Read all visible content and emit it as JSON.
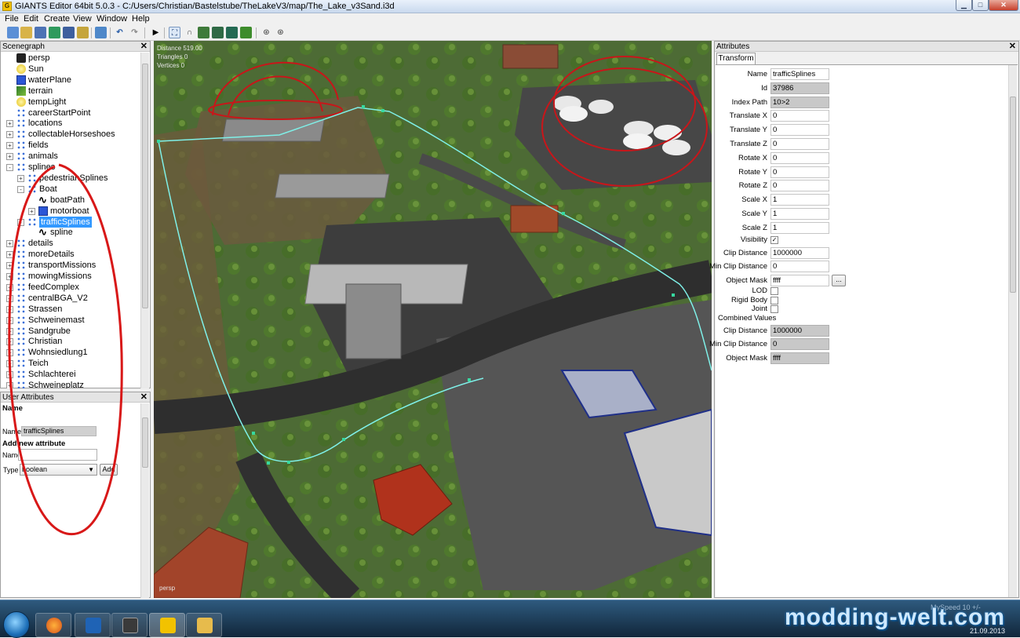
{
  "window": {
    "title": "GIANTS Editor 64bit 5.0.3 - C:/Users/Christian/Bastelstube/TheLakeV3/map/The_Lake_v3Sand.i3d",
    "app_icon_glyph": "G"
  },
  "menu": [
    "File",
    "Edit",
    "Create",
    "View",
    "Window",
    "Help"
  ],
  "toolbar": {
    "icons": [
      "new-file-icon",
      "open-folder-icon",
      "save-icon",
      "reload-icon",
      "save-as-icon",
      "export-icon",
      "import-icon",
      "undo-icon",
      "redo-icon",
      "play-icon",
      "select-mode-icon",
      "move-mode-icon",
      "terrain-sculpt-icon",
      "terrain-paint-icon",
      "foliage-paint-icon",
      "plant-icon",
      "camera-icon",
      "settings-icon"
    ]
  },
  "scenegraph": {
    "title": "Scenegraph",
    "nodes": [
      {
        "label": "persp",
        "icon": "camera-icon",
        "depth": 0,
        "expander": ""
      },
      {
        "label": "Sun",
        "icon": "light-icon",
        "depth": 0,
        "expander": ""
      },
      {
        "label": "waterPlane",
        "icon": "shape-icon",
        "depth": 0,
        "expander": ""
      },
      {
        "label": "terrain",
        "icon": "terrain-icon",
        "depth": 0,
        "expander": ""
      },
      {
        "label": "tempLight",
        "icon": "light-icon",
        "depth": 0,
        "expander": ""
      },
      {
        "label": "careerStartPoint",
        "icon": "transform-group-icon",
        "depth": 0,
        "expander": ""
      },
      {
        "label": "locations",
        "icon": "transform-group-icon",
        "depth": 0,
        "expander": "+"
      },
      {
        "label": "collectableHorseshoes",
        "icon": "transform-group-icon",
        "depth": 0,
        "expander": "+"
      },
      {
        "label": "fields",
        "icon": "transform-group-icon",
        "depth": 0,
        "expander": "+"
      },
      {
        "label": "animals",
        "icon": "transform-group-icon",
        "depth": 0,
        "expander": "+"
      },
      {
        "label": "splines",
        "icon": "transform-group-icon",
        "depth": 0,
        "expander": "-"
      },
      {
        "label": "pedestrianSplines",
        "icon": "transform-group-icon",
        "depth": 1,
        "expander": "+"
      },
      {
        "label": "Boat",
        "icon": "transform-group-icon",
        "depth": 1,
        "expander": "-"
      },
      {
        "label": "boatPath",
        "icon": "spline-icon",
        "depth": 2,
        "expander": ""
      },
      {
        "label": "motorboat",
        "icon": "shape-icon",
        "depth": 2,
        "expander": "+"
      },
      {
        "label": "trafficSplines",
        "icon": "transform-group-icon",
        "depth": 1,
        "expander": "-",
        "selected": true
      },
      {
        "label": "spline",
        "icon": "spline-icon",
        "depth": 2,
        "expander": ""
      },
      {
        "label": "details",
        "icon": "transform-group-icon",
        "depth": 0,
        "expander": "+"
      },
      {
        "label": "moreDetails",
        "icon": "transform-group-icon",
        "depth": 0,
        "expander": "+"
      },
      {
        "label": "transportMissions",
        "icon": "transform-group-icon",
        "depth": 0,
        "expander": "+"
      },
      {
        "label": "mowingMissions",
        "icon": "transform-group-icon",
        "depth": 0,
        "expander": "+"
      },
      {
        "label": "feedComplex",
        "icon": "transform-group-icon",
        "depth": 0,
        "expander": "+"
      },
      {
        "label": "centralBGA_V2",
        "icon": "transform-group-icon",
        "depth": 0,
        "expander": "+"
      },
      {
        "label": "Strassen",
        "icon": "transform-group-icon",
        "depth": 0,
        "expander": "+"
      },
      {
        "label": "Schweinemast",
        "icon": "transform-group-icon",
        "depth": 0,
        "expander": "+"
      },
      {
        "label": "Sandgrube",
        "icon": "transform-group-icon",
        "depth": 0,
        "expander": "+"
      },
      {
        "label": "Christian",
        "icon": "transform-group-icon",
        "depth": 0,
        "expander": "+"
      },
      {
        "label": "Wohnsiedlung1",
        "icon": "transform-group-icon",
        "depth": 0,
        "expander": "+"
      },
      {
        "label": "Teich",
        "icon": "transform-group-icon",
        "depth": 0,
        "expander": "+"
      },
      {
        "label": "Schlachterei",
        "icon": "transform-group-icon",
        "depth": 0,
        "expander": "+"
      },
      {
        "label": "Schweineplatz",
        "icon": "transform-group-icon",
        "depth": 0,
        "expander": "+"
      }
    ]
  },
  "user_attributes": {
    "title": "User Attributes",
    "heading": "Name",
    "name_label": "Name",
    "name_value": "trafficSplines",
    "add_heading": "Add new attribute",
    "new_name_label": "Name",
    "new_name_value": "",
    "type_label": "Type",
    "type_value": "boolean",
    "add_button": "Add"
  },
  "viewport": {
    "stats": [
      "Distance 519.00",
      "Triangles 0",
      "Vertices 0"
    ],
    "camera_label": "persp"
  },
  "attributes": {
    "title": "Attributes",
    "tab": "Transform",
    "fields": [
      {
        "label": "Name",
        "value": "trafficSplines",
        "readonly": false
      },
      {
        "label": "Id",
        "value": "37986",
        "readonly": true
      },
      {
        "label": "Index Path",
        "value": "10>2",
        "readonly": true
      },
      {
        "label": "Translate X",
        "value": "0",
        "readonly": false
      },
      {
        "label": "Translate Y",
        "value": "0",
        "readonly": false
      },
      {
        "label": "Translate Z",
        "value": "0",
        "readonly": false
      },
      {
        "label": "Rotate X",
        "value": "0",
        "readonly": false
      },
      {
        "label": "Rotate Y",
        "value": "0",
        "readonly": false
      },
      {
        "label": "Rotate Z",
        "value": "0",
        "readonly": false
      },
      {
        "label": "Scale X",
        "value": "1",
        "readonly": false
      },
      {
        "label": "Scale Y",
        "value": "1",
        "readonly": false
      },
      {
        "label": "Scale Z",
        "value": "1",
        "readonly": false
      }
    ],
    "visibility_label": "Visibility",
    "visibility_checked": true,
    "clip_fields": [
      {
        "label": "Clip Distance",
        "value": "1000000",
        "readonly": false
      },
      {
        "label": "Min Clip Distance",
        "value": "0",
        "readonly": false
      },
      {
        "label": "Object Mask",
        "value": "ffff",
        "readonly": false
      }
    ],
    "ellipsis_button": "...",
    "checks": [
      {
        "label": "LOD",
        "checked": false
      },
      {
        "label": "Rigid Body",
        "checked": false
      },
      {
        "label": "Joint",
        "checked": false
      }
    ],
    "combined_heading": "Combined Values",
    "combined_fields": [
      {
        "label": "Clip Distance",
        "value": "1000000",
        "readonly": true
      },
      {
        "label": "Min Clip Distance",
        "value": "0",
        "readonly": true
      },
      {
        "label": "Object Mask",
        "value": "ffff",
        "readonly": true
      }
    ]
  },
  "taskbar": {
    "apps": [
      "firefox-icon",
      "outlook-icon",
      "terminal-icon",
      "giants-editor-icon",
      "file-explorer-icon"
    ],
    "watermark": "modding-welt.com",
    "tray_text": "MySpeed 10 +/-",
    "date": "21.09.2013"
  },
  "colors": {
    "selection": "#3399ff",
    "annotation_red": "#d81818",
    "spline_cyan": "#7ff0e8",
    "grass": "#4d6b35"
  }
}
